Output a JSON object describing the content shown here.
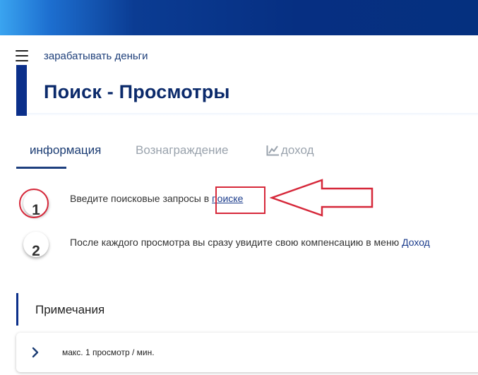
{
  "header": {
    "menu_icon": "hamburger-icon",
    "breadcrumb": "зарабатывать деньги",
    "title": "Поиск - Просмотры"
  },
  "tabs": [
    {
      "label": "информация",
      "active": true
    },
    {
      "label": "Вознаграждение",
      "active": false
    },
    {
      "label": "доход",
      "active": false,
      "icon": "chart-line-icon"
    }
  ],
  "steps": [
    {
      "number": "1",
      "text": "Введите поисковые запросы в ",
      "link": "поиске"
    },
    {
      "number": "2",
      "text": "После каждого просмотра вы сразу увидите свою компенсацию в меню ",
      "link": "Доход"
    }
  ],
  "notes": {
    "title": "Примечания",
    "items": [
      {
        "icon": "chevron-right-icon",
        "text": "макс. 1 просмотр / мин."
      }
    ]
  },
  "colors": {
    "accent": "#0b2f8a",
    "annotation": "#d6283a"
  }
}
